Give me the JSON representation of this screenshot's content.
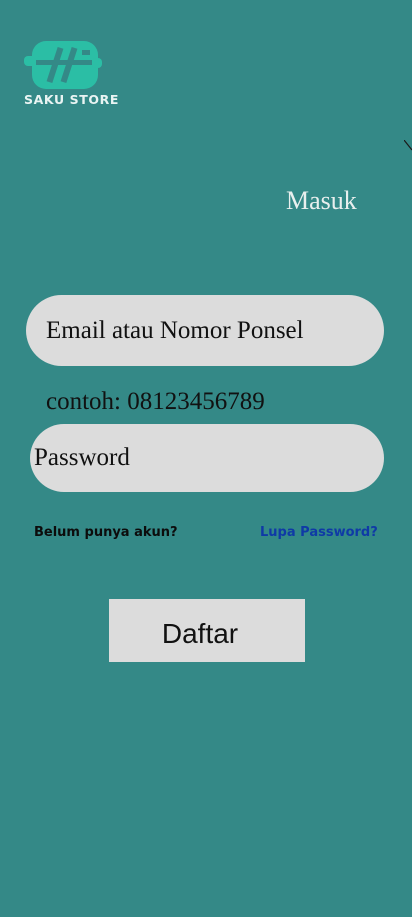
{
  "app": {
    "logo_text": "SAKU STORE",
    "logo_icon": "sb-monogram-logo",
    "accent": "#2bbea5",
    "background": "#348987"
  },
  "header": {
    "title": "Masuk"
  },
  "form": {
    "email_placeholder": "Email atau Nomor Ponsel",
    "email_hint": "contoh: 08123456789",
    "password_placeholder": "Password"
  },
  "links": {
    "register": "Belum punya akun?",
    "forgot": "Lupa Password?"
  },
  "actions": {
    "submit_label": "Daftar"
  }
}
